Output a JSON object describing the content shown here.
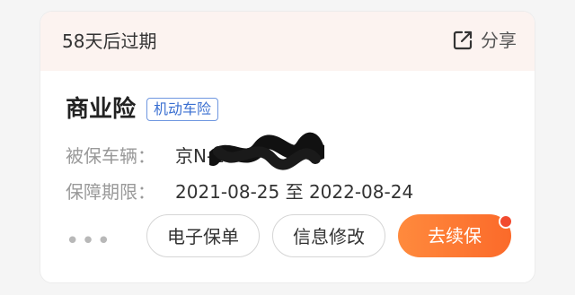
{
  "header": {
    "expiry_text": "58天后过期",
    "share_label": "分享"
  },
  "policy": {
    "title": "商业险",
    "tag": "机动车险",
    "vehicle_label": "被保车辆：",
    "vehicle_value": "京N-L6",
    "period_label": "保障期限：",
    "period_value": "2021-08-25 至 2022-08-24"
  },
  "actions": {
    "more_label": "•••",
    "policy_button": "电子保单",
    "modify_button": "信息修改",
    "renew_button": "去续保"
  },
  "colors": {
    "accent": "#fb6a2a",
    "header_bg": "#fcf3f0",
    "tag": "#3a6fd1",
    "notification_dot": "#f24a2e"
  },
  "icons": {
    "share": "share-icon",
    "more": "more-dots-icon"
  }
}
